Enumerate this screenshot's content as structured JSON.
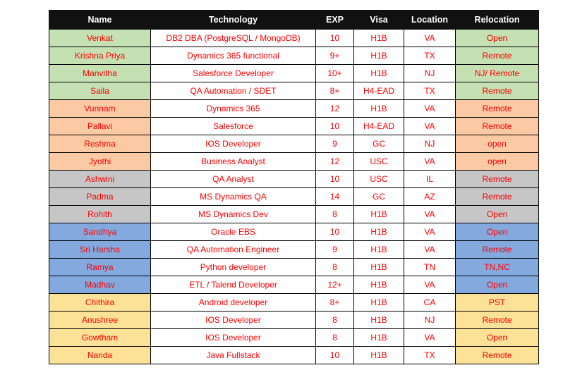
{
  "table": {
    "name": "candidate-hotlist-table",
    "columns": [
      {
        "key": "name",
        "label": "Name"
      },
      {
        "key": "technology",
        "label": "Technology"
      },
      {
        "key": "exp",
        "label": "EXP"
      },
      {
        "key": "visa",
        "label": "Visa"
      },
      {
        "key": "location",
        "label": "Location"
      },
      {
        "key": "relocation",
        "label": "Relocation"
      }
    ],
    "header_background": "#111111",
    "header_text_color": "#FFFFFF",
    "cell_text_color": "#FF0000",
    "group_colors": {
      "green": "#C5E0B3",
      "orange": "#FBC9A4",
      "gray": "#C6C6C6",
      "blue": "#83A9DF",
      "yellow": "#FCE296"
    },
    "rows": [
      {
        "group": "green",
        "name": "Venkat",
        "technology": "DB2 DBA (PostgreSQL / MongoDB)",
        "exp": "10",
        "visa": "H1B",
        "location": "VA",
        "relocation": "Open"
      },
      {
        "group": "green",
        "name": "Krishna Priya",
        "technology": "Dynamics 365 functional",
        "exp": "9+",
        "visa": "H1B",
        "location": "TX",
        "relocation": "Remote"
      },
      {
        "group": "green",
        "name": "Manvitha",
        "technology": "Salesforce Developer",
        "exp": "10+",
        "visa": "H1B",
        "location": "NJ",
        "relocation": "NJ/ Remote"
      },
      {
        "group": "green",
        "name": "Saila",
        "technology": "QA Automation / SDET",
        "exp": "8+",
        "visa": "H4-EAD",
        "location": "TX",
        "relocation": "Remote"
      },
      {
        "group": "orange",
        "name": "Vunnam",
        "technology": "Dynamics 365",
        "exp": "12",
        "visa": "H1B",
        "location": "VA",
        "relocation": "Remote"
      },
      {
        "group": "orange",
        "name": "Pallavi",
        "technology": "Salesforce",
        "exp": "10",
        "visa": "H4-EAD",
        "location": "VA",
        "relocation": "Remote"
      },
      {
        "group": "orange",
        "name": "Reshma",
        "technology": "IOS Developer",
        "exp": "9",
        "visa": "GC",
        "location": "NJ",
        "relocation": "open"
      },
      {
        "group": "orange",
        "name": "Jyothi",
        "technology": "Business Analyst",
        "exp": "12",
        "visa": "USC",
        "location": "VA",
        "relocation": "open"
      },
      {
        "group": "gray",
        "name": "Ashwini",
        "technology": "QA Analyst",
        "exp": "10",
        "visa": "USC",
        "location": "IL",
        "relocation": "Remote"
      },
      {
        "group": "gray",
        "name": "Padma",
        "technology": "MS Dynamics QA",
        "exp": "14",
        "visa": "GC",
        "location": "AZ",
        "relocation": "Remote"
      },
      {
        "group": "gray",
        "name": "Rohith",
        "technology": "MS Dynamics Dev",
        "exp": "8",
        "visa": "H1B",
        "location": "VA",
        "relocation": "Open"
      },
      {
        "group": "blue",
        "name": "Sandhya",
        "technology": "Oracle EBS",
        "exp": "10",
        "visa": "H1B",
        "location": "VA",
        "relocation": "Open"
      },
      {
        "group": "blue",
        "name": "Sri Harsha",
        "technology": "QA Automation Engineer",
        "exp": "9",
        "visa": "H1B",
        "location": "VA",
        "relocation": "Remote"
      },
      {
        "group": "blue",
        "name": "Ramya",
        "technology": "Python developer",
        "exp": "8",
        "visa": "H1B",
        "location": "TN",
        "relocation": "TN,NC"
      },
      {
        "group": "blue",
        "name": "Madhav",
        "technology": "ETL / Talend Developer",
        "exp": "12+",
        "visa": "H1B",
        "location": "VA",
        "relocation": "Open"
      },
      {
        "group": "yellow",
        "name": "Chithira",
        "technology": "Android developer",
        "exp": "8+",
        "visa": "H1B",
        "location": "CA",
        "relocation": "PST"
      },
      {
        "group": "yellow",
        "name": "Anushree",
        "technology": "IOS Developer",
        "exp": "8",
        "visa": "H1B",
        "location": "NJ",
        "relocation": "Remote"
      },
      {
        "group": "yellow",
        "name": "Gowtham",
        "technology": "IOS Developer",
        "exp": "8",
        "visa": "H1B",
        "location": "VA",
        "relocation": "Open"
      },
      {
        "group": "yellow",
        "name": "Nanda",
        "technology": "Java Fullstack",
        "exp": "10",
        "visa": "H1B",
        "location": "TX",
        "relocation": "Remote"
      }
    ]
  }
}
